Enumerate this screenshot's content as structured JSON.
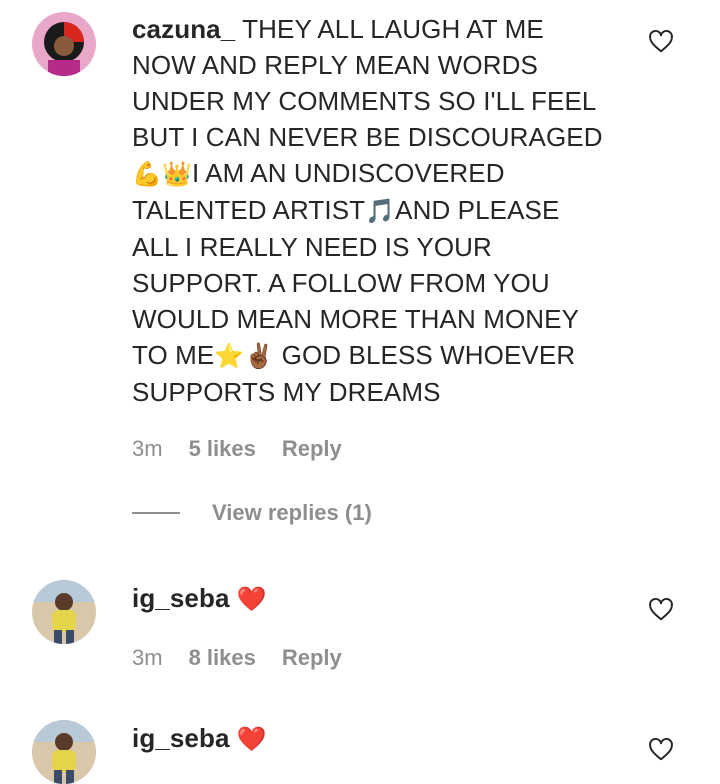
{
  "comments": [
    {
      "username": "cazuna_",
      "lines": [
        " THEY ALL LAUGH AT ME",
        "NOW AND REPLY MEAN WORDS",
        "UNDER MY COMMENTS SO I'LL FEEL",
        "BUT I CAN NEVER BE DISCOURAGED"
      ],
      "line5": [
        "💪",
        "👑",
        "I AM AN UNDISCOVERED"
      ],
      "line6": [
        "TALENTED ARTIST",
        "🎵",
        "AND PLEASE"
      ],
      "lines_b": [
        "ALL I REALLY NEED IS YOUR",
        "SUPPORT. A FOLLOW FROM YOU",
        "WOULD MEAN MORE THAN MONEY"
      ],
      "line10": [
        "TO ME",
        "⭐",
        "✌🏾",
        " GOD BLESS WHOEVER"
      ],
      "line11": "SUPPORTS MY DREAMS",
      "time": "3m",
      "likes": "5 likes",
      "reply_label": "Reply",
      "view_replies": "View replies (1)"
    },
    {
      "username": "ig_seba",
      "text": "❤️",
      "time": "3m",
      "likes": "8 likes",
      "reply_label": "Reply"
    },
    {
      "username": "ig_seba",
      "text": "❤️"
    }
  ],
  "icons": {
    "like": "heart-outline-icon"
  }
}
